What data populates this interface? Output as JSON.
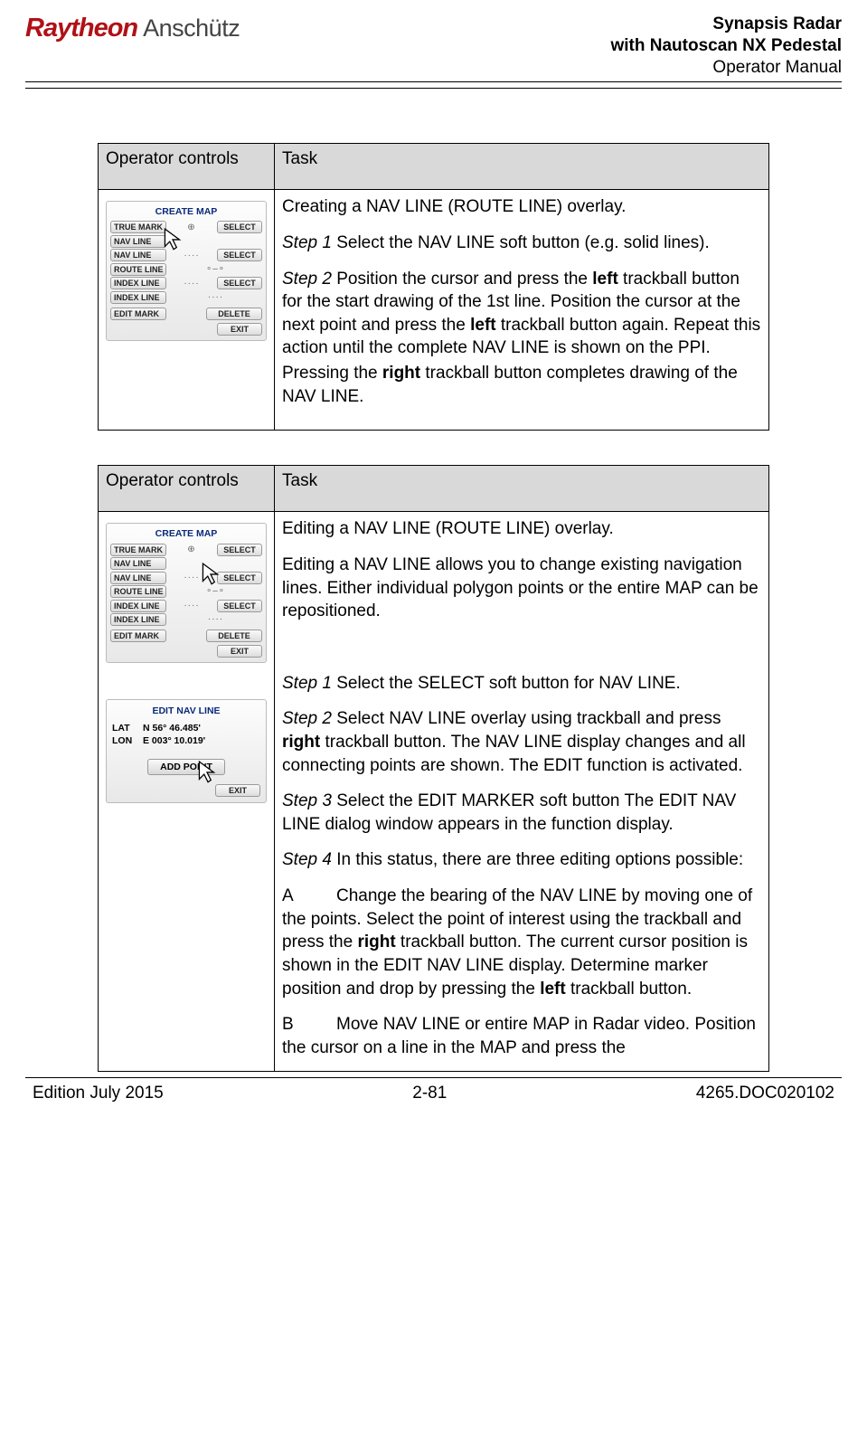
{
  "header": {
    "logo_brand": "Raytheon",
    "logo_sub": "Anschütz",
    "title_line1": "Synapsis Radar",
    "title_line2": "with Nautoscan NX Pedestal",
    "title_line3": "Operator Manual"
  },
  "tables": {
    "col_left": "Operator controls",
    "col_right": "Task"
  },
  "panel1": {
    "title": "CREATE MAP",
    "rows": [
      {
        "left": "TRUE MARK",
        "mid": "⊕",
        "right": "SELECT"
      },
      {
        "left": "NAV LINE",
        "mid": "",
        "right": ""
      },
      {
        "left": "NAV LINE",
        "mid": "····",
        "right": "SELECT"
      },
      {
        "left": "ROUTE LINE",
        "mid": "∘–∘",
        "right": ""
      },
      {
        "left": "INDEX LINE",
        "mid": "····",
        "right": "SELECT"
      },
      {
        "left": "INDEX LINE",
        "mid": "····",
        "right": ""
      }
    ],
    "edit_mark": "EDIT MARK",
    "delete": "DELETE",
    "exit": "EXIT"
  },
  "task1": {
    "heading": "Creating a NAV LINE (ROUTE LINE) overlay.",
    "step1_label": "Step 1",
    "step1_text": " Select the NAV LINE soft button (e.g. solid lines).",
    "step2_label": "Step 2",
    "step2_a": " Position the cursor and press the ",
    "step2_b": "left",
    "step2_c": " trackball button for the start drawing of the 1st line. Position the cursor at the next point and press the ",
    "step2_d": "left",
    "step2_e": " trackball button again. Repeat this action until the complete NAV LINE is shown on the PPI.",
    "step2_f": "Pressing the ",
    "step2_g": "right",
    "step2_h": " trackball button completes drawing of the NAV LINE."
  },
  "panel2": {
    "title": "CREATE MAP",
    "rows": [
      {
        "left": "TRUE MARK",
        "mid": "⊕",
        "right": "SELECT"
      },
      {
        "left": "NAV LINE",
        "mid": "",
        "right": ""
      },
      {
        "left": "NAV LINE",
        "mid": "····",
        "right": "SELECT"
      },
      {
        "left": "ROUTE LINE",
        "mid": "∘–∘",
        "right": ""
      },
      {
        "left": "INDEX LINE",
        "mid": "····",
        "right": "SELECT"
      },
      {
        "left": "INDEX LINE",
        "mid": "····",
        "right": ""
      }
    ],
    "edit_mark": "EDIT MARK",
    "delete": "DELETE",
    "exit": "EXIT"
  },
  "panel3": {
    "title": "EDIT NAV LINE",
    "lat_label": "LAT",
    "lat_val": "N 56° 46.485'",
    "lon_label": "LON",
    "lon_val": "E 003° 10.019'",
    "add_point": "ADD POINT",
    "exit": "EXIT"
  },
  "task2": {
    "heading": "Editing a NAV LINE (ROUTE LINE) overlay.",
    "intro": "Editing a NAV LINE allows you to change existing navigation lines. Either individual polygon points or the entire MAP can be repositioned.",
    "step1_label": "Step 1",
    "step1_text": " Select the SELECT soft button for NAV LINE.",
    "step2_label": "Step 2",
    "step2_a": " Select NAV LINE overlay using trackball and press ",
    "step2_b": "right",
    "step2_c": " trackball button. The NAV LINE display changes and all connecting points are shown. The EDIT function is activated.",
    "step3_label": "Step 3",
    "step3_text": " Select the EDIT MARKER soft button The EDIT NAV LINE dialog window appears in the function display.",
    "step4_label": "Step 4",
    "step4_text": " In this status, there are three editing options possible:",
    "optA_label": "A",
    "optA_a": "Change the bearing of the NAV LINE by moving one of the points. Select the point of interest using the trackball and press the ",
    "optA_b": "right",
    "optA_c": " trackball button. The current cursor position is shown in the EDIT NAV LINE display. Determine marker position and drop by pressing the ",
    "optA_d": "left",
    "optA_e": " trackball button.",
    "optB_label": "B",
    "optB_text": "Move NAV LINE or entire MAP in Radar video. Position the cursor on a line in the MAP and press the"
  },
  "footer": {
    "left": "Edition July 2015",
    "center": "2-81",
    "right": "4265.DOC020102"
  }
}
